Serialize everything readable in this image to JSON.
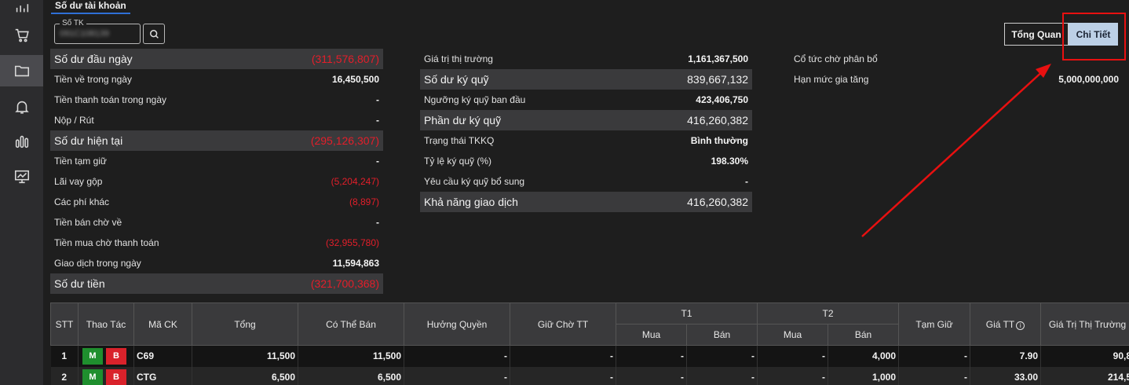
{
  "sidebar": {
    "items": [
      {
        "icon": "bar-chart-icon"
      },
      {
        "icon": "cart-icon"
      },
      {
        "icon": "folder-icon",
        "active": true
      },
      {
        "icon": "bell-icon"
      },
      {
        "icon": "analytics-icon"
      },
      {
        "icon": "monitor-chart-icon"
      }
    ]
  },
  "tab": {
    "label": "Số dư tài khoản"
  },
  "account": {
    "label": "Số TK",
    "value": "091C108139"
  },
  "view_toggle": {
    "overview": "Tổng Quan",
    "detail": "Chi Tiết"
  },
  "colors": {
    "negative": "#e41e2a",
    "accent": "#2f6fd6",
    "annotation": "#e81010"
  },
  "balance": {
    "left": [
      {
        "label": "Số dư đầu ngày",
        "value": "(311,576,807)"
      },
      {
        "label": "Tiền về trong ngày",
        "value": "16,450,500"
      },
      {
        "label": "Tiền thanh toán trong ngày",
        "value": "-"
      },
      {
        "label": "Nộp / Rút",
        "value": "-"
      },
      {
        "label": "Số dư hiện tại",
        "value": "(295,126,307)"
      },
      {
        "label": "Tiền tạm giữ",
        "value": "-"
      },
      {
        "label": "Lãi vay gộp",
        "value": "(5,204,247)"
      },
      {
        "label": "Các phí khác",
        "value": "(8,897)"
      },
      {
        "label": "Tiền bán chờ về",
        "value": "-"
      },
      {
        "label": "Tiền mua chờ thanh toán",
        "value": "(32,955,780)"
      },
      {
        "label": "Giao dịch trong ngày",
        "value": "11,594,863"
      },
      {
        "label": "Số dư tiền",
        "value": "(321,700,368)"
      }
    ],
    "middle": [
      {
        "label": "Giá trị thị trường",
        "value": "1,161,367,500"
      },
      {
        "label": "Số dư ký quỹ",
        "value": "839,667,132"
      },
      {
        "label": "Ngưỡng ký quỹ ban đầu",
        "value": "423,406,750"
      },
      {
        "label": "Phần dư ký quỹ",
        "value": "416,260,382"
      },
      {
        "label": "Trạng thái TKKQ",
        "value": "Bình thường"
      },
      {
        "label": "Tỷ lệ ký quỹ (%)",
        "value": "198.30%"
      },
      {
        "label": "Yêu cầu ký quỹ bổ sung",
        "value": "-"
      },
      {
        "label": "Khả năng giao dịch",
        "value": "416,260,382"
      }
    ],
    "right": [
      {
        "label": "Cổ tức chờ phân bổ",
        "value": ""
      },
      {
        "label": "Hạn mức gia tăng",
        "value": "5,000,000,000"
      }
    ]
  },
  "table": {
    "headers": {
      "stt": "STT",
      "action": "Thao Tác",
      "symbol": "Mã CK",
      "total": "Tổng",
      "sellable": "Có Thể Bán",
      "rights": "Hưởng Quyền",
      "pending": "Giữ Chờ TT",
      "t1": "T1",
      "t2": "T2",
      "buy": "Mua",
      "sell": "Bán",
      "hold": "Tạm Giữ",
      "price": "Giá TT",
      "market_value": "Giá Trị Thị Trường"
    },
    "action_buy": "M",
    "action_sell": "B",
    "rows": [
      {
        "stt": "1",
        "symbol": "C69",
        "total": "11,500",
        "sellable": "11,500",
        "rights": "-",
        "pending": "-",
        "t1_buy": "-",
        "t1_sell": "-",
        "t2_buy": "-",
        "t2_sell": "4,000",
        "hold": "-",
        "price": "7.90",
        "market_value": "90,8"
      },
      {
        "stt": "2",
        "symbol": "CTG",
        "total": "6,500",
        "sellable": "6,500",
        "rights": "-",
        "pending": "-",
        "t1_buy": "-",
        "t1_sell": "-",
        "t2_buy": "-",
        "t2_sell": "1,000",
        "hold": "-",
        "price": "33.00",
        "market_value": "214,5"
      }
    ]
  }
}
